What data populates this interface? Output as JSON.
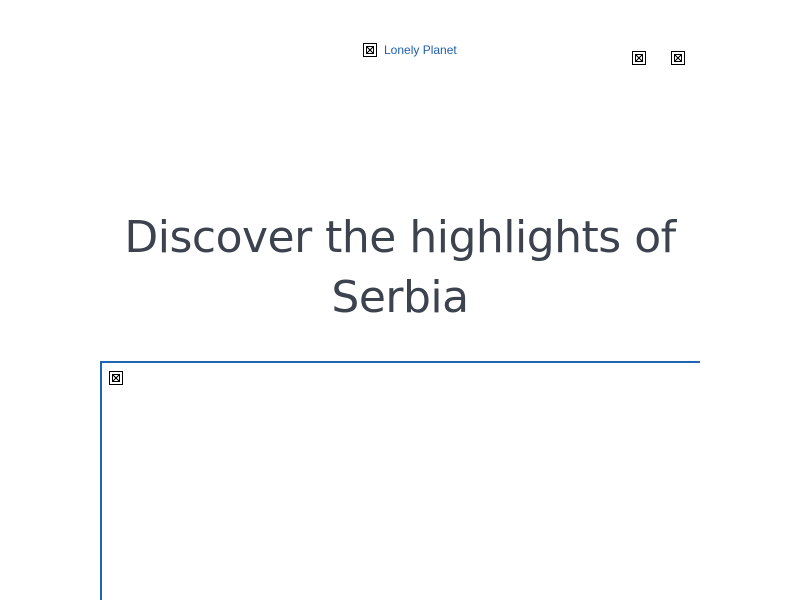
{
  "header": {
    "logo_alt": "Lonely Planet",
    "logo_icon": "broken-image-icon",
    "right_icons": [
      "broken-image-icon",
      "broken-image-icon"
    ]
  },
  "main": {
    "headline": "Discover the highlights of Serbia",
    "hero_image_icon": "broken-image-icon"
  },
  "colors": {
    "link": "#1f5fae",
    "headline": "#3c434e",
    "frame_border": "#1e65b6"
  }
}
